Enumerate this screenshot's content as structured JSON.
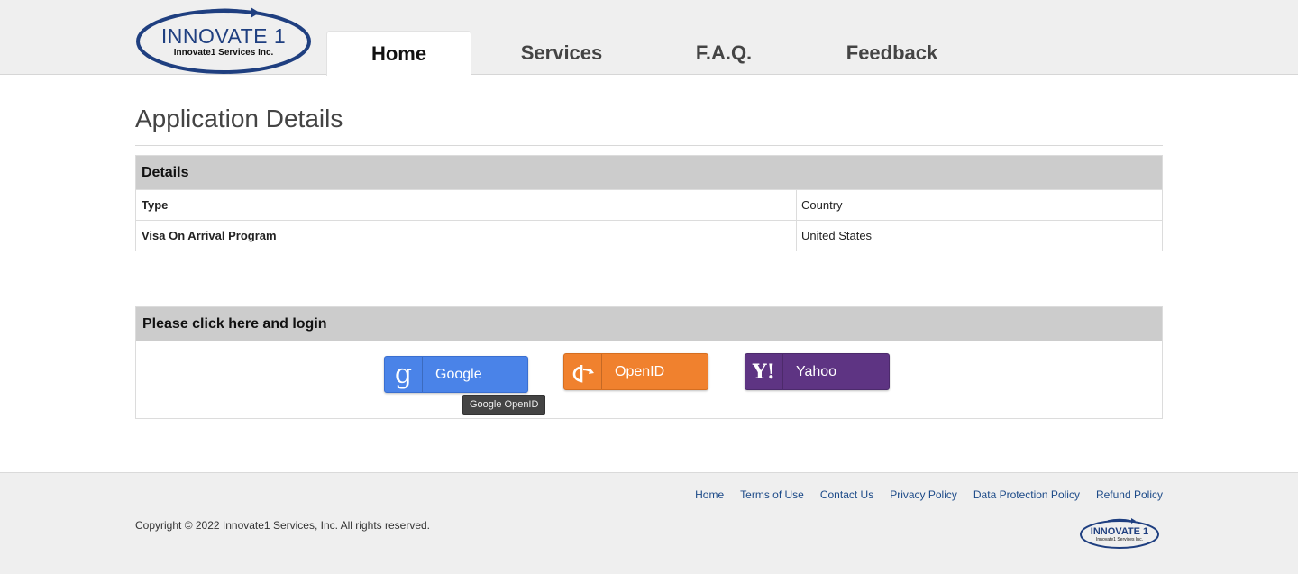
{
  "logo": {
    "title": "INNOVATE 1",
    "subtitle": "Innovate1 Services Inc."
  },
  "nav": {
    "tabs": [
      {
        "label": "Home",
        "active": true
      },
      {
        "label": "Services",
        "active": false
      },
      {
        "label": "F.A.Q.",
        "active": false
      },
      {
        "label": "Feedback",
        "active": false
      }
    ]
  },
  "main": {
    "title": "Application Details",
    "details": {
      "heading": "Details",
      "rows": [
        {
          "label": "Type",
          "value": "Country"
        },
        {
          "label": "Visa On Arrival Program",
          "value": "United States"
        }
      ]
    },
    "login": {
      "heading": "Please click here and login",
      "buttons": {
        "google": {
          "label": "Google",
          "icon_glyph": "g",
          "icon": "google-g-icon",
          "color": "#4a83e8"
        },
        "openid": {
          "label": "OpenID",
          "icon": "openid-icon",
          "color": "#f0812e"
        },
        "yahoo": {
          "label": "Yahoo",
          "icon_glyph": "Y!",
          "icon": "yahoo-icon",
          "color": "#5e3483"
        }
      },
      "tooltip": "Google OpenID"
    }
  },
  "footer": {
    "links": [
      "Home",
      "Terms of Use",
      "Contact Us",
      "Privacy Policy",
      "Data Protection Policy",
      "Refund Policy"
    ],
    "copyright": "Copyright © 2022 Innovate1 Services, Inc. All rights reserved.",
    "logo_title": "INNOVATE 1",
    "logo_subtitle": "Innovate1 Services Inc."
  },
  "colors": {
    "brand_blue": "#1f3f80",
    "header_bg": "#efefef",
    "section_head_bg": "#cccccc",
    "link": "#1c4a88"
  }
}
